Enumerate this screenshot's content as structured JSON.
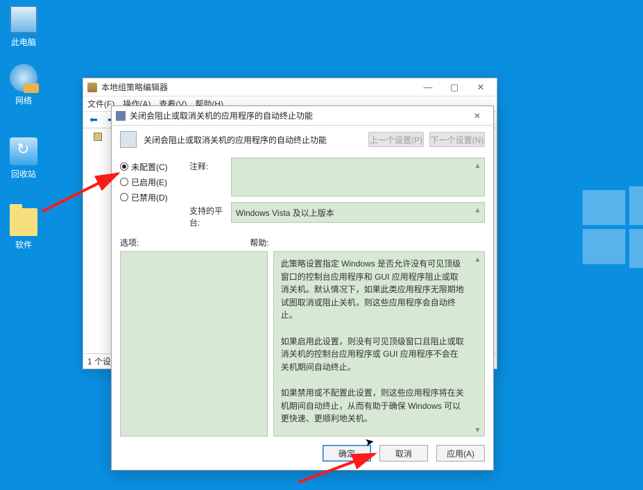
{
  "desktop": {
    "icons": [
      "此电脑",
      "网络",
      "回收站",
      "软件"
    ]
  },
  "editor_window": {
    "title": "本地组策略编辑器",
    "menus": [
      "文件(F)",
      "操作(A)",
      "查看(V)",
      "帮助(H)"
    ],
    "status": "1 个设置"
  },
  "dialog": {
    "title": "关闭会阻止或取消关机的应用程序的自动终止功能",
    "heading": "关闭会阻止或取消关机的应用程序的自动终止功能",
    "nav_prev": "上一个设置(P)",
    "nav_next": "下一个设置(N)",
    "radios": {
      "not_configured": "未配置(C)",
      "enabled": "已启用(E)",
      "disabled": "已禁用(D)"
    },
    "comment_label": "注释:",
    "platform_label": "支持的平台:",
    "platform_value": "Windows Vista 及以上版本",
    "options_label": "选项:",
    "help_label": "帮助:",
    "help_text": "此策略设置指定 Windows 是否允许没有可见顶级窗口的控制台应用程序和 GUI 应用程序阻止或取消关机。默认情况下，如果此类应用程序无限期地试图取消或阻止关机，则这些应用程序会自动终止。\n\n如果启用此设置，则没有可见顶级窗口且阻止或取消关机的控制台应用程序或 GUI 应用程序不会在关机期间自动终止。\n\n如果禁用或不配置此设置，则这些应用程序将在关机期间自动终止，从而有助于确保 Windows 可以更快速、更顺利地关机。",
    "buttons": {
      "ok": "确定",
      "cancel": "取消",
      "apply": "应用(A)"
    }
  }
}
